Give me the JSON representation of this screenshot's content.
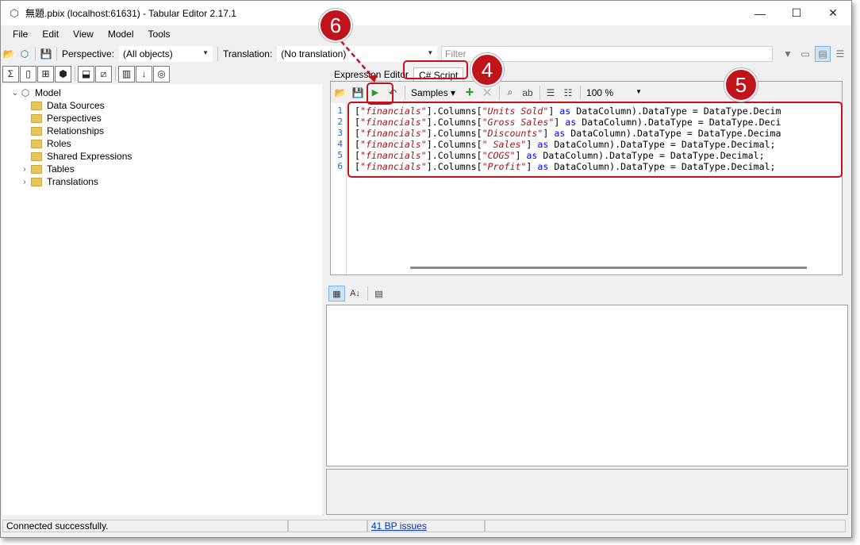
{
  "window": {
    "title": "無題.pbix (localhost:61631) - Tabular Editor 2.17.1",
    "minimize": "—",
    "maximize": "☐",
    "close": "✕"
  },
  "menu": [
    "File",
    "Edit",
    "View",
    "Model",
    "Tools"
  ],
  "toolbar": {
    "perspective_label": "Perspective:",
    "perspective_value": "(All objects)",
    "translation_label": "Translation:",
    "translation_value": "(No translation)",
    "filter_placeholder": "Filter"
  },
  "tree": {
    "root": "Model",
    "items": [
      {
        "label": "Data Sources",
        "expandable": false
      },
      {
        "label": "Perspectives",
        "expandable": false
      },
      {
        "label": "Relationships",
        "expandable": false
      },
      {
        "label": "Roles",
        "expandable": false
      },
      {
        "label": "Shared Expressions",
        "expandable": false
      },
      {
        "label": "Tables",
        "expandable": true
      },
      {
        "label": "Translations",
        "expandable": true
      }
    ]
  },
  "tabs": {
    "expression_editor": "Expression Editor",
    "csharp_script": "C# Script"
  },
  "editor_toolbar": {
    "samples": "Samples",
    "zoom": "100 %"
  },
  "code": {
    "line_numbers": [
      "1",
      "2",
      "3",
      "4",
      "5",
      "6"
    ],
    "lines": [
      {
        "table": "\"financials\"",
        "mid": "].Columns[",
        "col": "\"Units Sold\"",
        "tail": " DataColumn).DataType = DataType.Decim"
      },
      {
        "table": "\"financials\"",
        "mid": "].Columns[",
        "col": "\"Gross Sales\"",
        "tail": " DataColumn).DataType = DataType.Deci"
      },
      {
        "table": "\"financials\"",
        "mid": "].Columns[",
        "col": "\"Discounts\"",
        "tail": " DataColumn).DataType = DataType.Decima"
      },
      {
        "table": "\"financials\"",
        "mid": "].Columns[",
        "col": "\" Sales\"",
        "tail": " DataColumn).DataType = DataType.Decimal;"
      },
      {
        "table": "\"financials\"",
        "mid": "].Columns[",
        "col": "\"COGS\"",
        "tail": " DataColumn).DataType = DataType.Decimal;"
      },
      {
        "table": "\"financials\"",
        "mid": "].Columns[",
        "col": "\"Profit\"",
        "tail": " DataColumn).DataType = DataType.Decimal;"
      }
    ],
    "open_bracket": "[",
    "close_bracket": "]",
    "keyword": "as"
  },
  "status": {
    "message": "Connected successfully.",
    "bp_issues": "41 BP issues"
  },
  "callouts": [
    "6",
    "4",
    "5"
  ],
  "colors": {
    "callout": "#c0141c",
    "string": "#a31515",
    "keyword": "#0000ff"
  }
}
